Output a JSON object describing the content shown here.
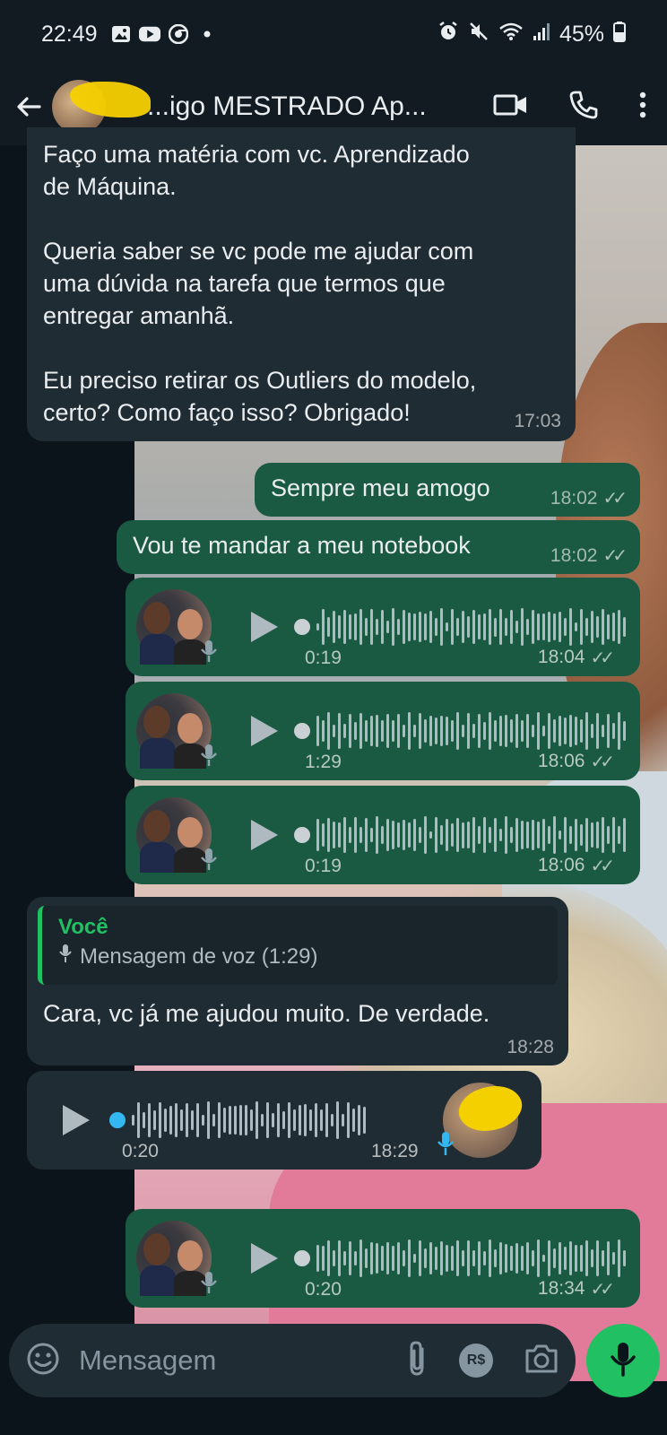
{
  "status_bar": {
    "time": "22:49",
    "battery": "45%",
    "left_icons": [
      "image-icon",
      "youtube-icon",
      "chrome-icon",
      "dot-icon"
    ],
    "right_icons": [
      "alarm-icon",
      "mute-icon",
      "wifi-icon",
      "signal-icon",
      "battery-icon"
    ]
  },
  "header": {
    "title": "...igo MESTRADO Ap...",
    "actions": [
      "video-call-icon",
      "phone-icon",
      "more-icon"
    ]
  },
  "messages": [
    {
      "type": "text",
      "direction": "in",
      "lines": [
        "Faço uma matéria com vc. Aprendizado",
        "de Máquina.",
        "",
        "Queria saber se vc pode me ajudar com",
        "uma dúvida na tarefa que termos que",
        "entregar amanhã.",
        "",
        "Eu preciso retirar os Outliers do modelo,",
        "certo? Como faço isso? Obrigado!"
      ],
      "time": "17:03"
    },
    {
      "type": "text",
      "direction": "out",
      "text": "Sempre meu amogo",
      "time": "18:02",
      "status": "✓✓"
    },
    {
      "type": "text",
      "direction": "out",
      "text": "Vou te mandar a meu notebook",
      "time": "18:02",
      "status": "✓✓"
    },
    {
      "type": "voice",
      "direction": "out",
      "duration": "0:19",
      "time": "18:04",
      "status": "✓✓"
    },
    {
      "type": "voice",
      "direction": "out",
      "duration": "1:29",
      "time": "18:06",
      "status": "✓✓"
    },
    {
      "type": "voice",
      "direction": "out",
      "duration": "0:19",
      "time": "18:06",
      "status": "✓✓"
    },
    {
      "type": "reply",
      "direction": "in",
      "quote_author": "Você",
      "quote_text": "Mensagem de voz (1:29)",
      "text": "Cara, vc já me ajudou muito. De verdade.",
      "time": "18:28"
    },
    {
      "type": "voice",
      "direction": "in",
      "duration": "0:20",
      "time": "18:29"
    },
    {
      "type": "voice",
      "direction": "out",
      "duration": "0:20",
      "time": "18:34",
      "status": "✓✓"
    }
  ],
  "input": {
    "placeholder": "Mensagem",
    "icons": [
      "emoji-icon",
      "attach-icon",
      "payment-icon",
      "camera-icon"
    ],
    "payment_label": "R$"
  },
  "colors": {
    "outgoing_bubble": "#1b5a42",
    "incoming_bubble": "#202c33",
    "header_bg": "#111b21",
    "accent_green": "#21c063",
    "quote_author": "#21c063"
  }
}
